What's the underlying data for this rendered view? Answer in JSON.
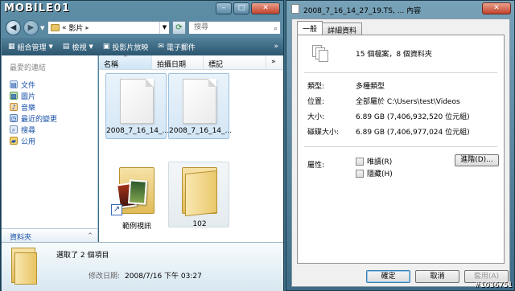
{
  "explorer": {
    "logo": "MOBILE01",
    "window_buttons": {
      "min": "–",
      "max": "□",
      "close": "✕"
    },
    "address": {
      "path_prefix": "«",
      "current": "影片",
      "separator": "▸"
    },
    "search_placeholder": "搜尋",
    "toolbar": [
      {
        "label": "組合管理",
        "icon": "▦"
      },
      {
        "label": "檢視",
        "icon": "▤"
      },
      {
        "label": "投影片放映",
        "icon": "▣"
      },
      {
        "label": "電子郵件",
        "icon": "✉"
      }
    ],
    "toolbar_more": "»",
    "nav": {
      "header": "最愛的連結",
      "items": [
        {
          "label": "文件",
          "icon": "▤"
        },
        {
          "label": "圖片",
          "icon": "▩"
        },
        {
          "label": "音樂",
          "icon": "♪"
        },
        {
          "label": "最近的變更",
          "icon": "◷"
        },
        {
          "label": "搜尋",
          "icon": "⌕"
        },
        {
          "label": "公用",
          "icon": "▰"
        }
      ],
      "folders_label": "資料夾",
      "folders_caret": "^"
    },
    "columns": {
      "name": "名稱",
      "date": "拍攝日期",
      "tags": "標記",
      "more": "»",
      "sort": "^"
    },
    "items": [
      {
        "label": "2008_7_16_14_..."
      },
      {
        "label": "2008_7_16_14_..."
      },
      {
        "label": "範例視訊"
      },
      {
        "label": "102"
      }
    ],
    "details": {
      "title": "選取了 2 個項目",
      "modified_label": "修改日期:",
      "modified_value": "2008/7/16 下午 03:27"
    }
  },
  "properties": {
    "title": "2008_7_16_14_27_19.TS, ... 內容",
    "close": "✕",
    "tabs": [
      "一般",
      "詳細資料"
    ],
    "summary": "15 個檔案，8 個資料夾",
    "rows": [
      {
        "label": "類型:",
        "value": "多種類型"
      },
      {
        "label": "位置:",
        "value": "全部屬於 C:\\Users\\test\\Videos"
      },
      {
        "label": "大小:",
        "value": "6.89 GB (7,406,932,520 位元組)"
      },
      {
        "label": "磁碟大小:",
        "value": "6.89 GB (7,406,977,024 位元組)"
      }
    ],
    "attributes_label": "屬性:",
    "readonly_label": "唯讀(R)",
    "hidden_label": "隱藏(H)",
    "advanced_label": "進階(D)...",
    "buttons": {
      "ok": "確定",
      "cancel": "取消",
      "apply": "套用(A)"
    }
  },
  "watermark": "#1036751"
}
